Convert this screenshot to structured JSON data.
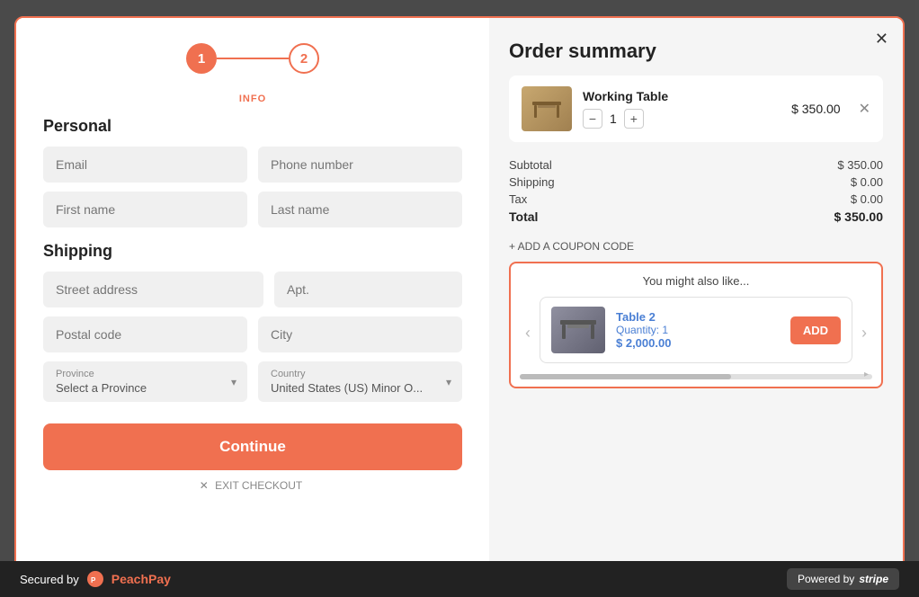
{
  "stepper": {
    "step1": "1",
    "step2": "2",
    "step1_label": "INFO"
  },
  "personal_section": {
    "title": "Personal",
    "email_placeholder": "Email",
    "phone_placeholder": "Phone number",
    "firstname_placeholder": "First name",
    "lastname_placeholder": "Last name"
  },
  "shipping_section": {
    "title": "Shipping",
    "street_placeholder": "Street address",
    "apt_placeholder": "Apt.",
    "postal_placeholder": "Postal code",
    "city_placeholder": "City",
    "province_label": "Province",
    "province_value": "Select a Province",
    "country_label": "Country",
    "country_value": "United States (US) Minor O..."
  },
  "continue_button": "Continue",
  "exit_text": "EXIT CHECKOUT",
  "order_summary": {
    "title": "Order summary",
    "item_name": "Working Table",
    "item_price": "$ 350.00",
    "quantity": "1",
    "subtotal_label": "Subtotal",
    "subtotal_value": "$ 350.00",
    "shipping_label": "Shipping",
    "shipping_value": "$ 0.00",
    "tax_label": "Tax",
    "tax_value": "$ 0.00",
    "total_label": "Total",
    "total_value": "$ 350.00",
    "coupon_link": "+ ADD A COUPON CODE"
  },
  "upsell": {
    "title": "You might also like...",
    "item_name": "Table 2",
    "item_qty": "Quantity: 1",
    "item_price": "$ 2,000.00",
    "add_button": "ADD"
  },
  "footer": {
    "secured_by": "Secured by",
    "brand": "PeachPay",
    "powered_by": "Powered by",
    "stripe": "stripe"
  }
}
